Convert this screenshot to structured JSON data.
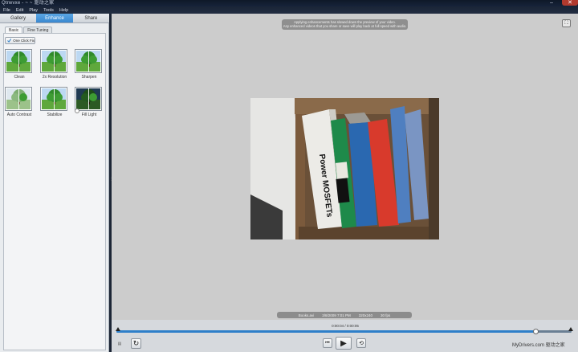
{
  "window": {
    "title": "Qtrwvxe - ~ ~ 驱动之家",
    "min_glyph": "–",
    "close_glyph": "✕"
  },
  "menu": [
    "File",
    "Edit",
    "Play",
    "Tools",
    "Help"
  ],
  "tabs": [
    {
      "label": "Gallery",
      "active": false
    },
    {
      "label": "Enhance",
      "active": true
    },
    {
      "label": "Share",
      "active": false
    }
  ],
  "subtabs": [
    {
      "label": "Basic",
      "active": true
    },
    {
      "label": "Fine Tuning",
      "active": false
    }
  ],
  "one_click_fix": {
    "label": "One Click Fix",
    "icon": "checkmark-icon"
  },
  "effects": [
    {
      "label": "Clean"
    },
    {
      "label": "2x Resolution"
    },
    {
      "label": "Sharpen"
    },
    {
      "label": "Auto Contrast"
    },
    {
      "label": "Stabilize"
    },
    {
      "label": "Fill Light"
    }
  ],
  "notice": {
    "line1": "Applying enhancements has slowed down the preview of your video.",
    "line2": "Any enhanced videos that you share or save will play back at full speed with audio."
  },
  "fullscreen": {
    "icon": "fullscreen-icon",
    "glyph": "⛶"
  },
  "info": {
    "filename": "Books.avi",
    "date": "3/8/2009 7:01 PM",
    "resolution": "320x240",
    "fps": "30 fps"
  },
  "player": {
    "timecode": "0:00:04 / 0:00:05",
    "progress": 0.92,
    "mute_glyph": "▤",
    "rotate_glyph": "↻",
    "prev_glyph": "⏮",
    "play_glyph": "▶",
    "loop_glyph": "⟲"
  },
  "watermark": "MyDrivers.com 驱动之家",
  "colors": {
    "accent": "#3a88d0",
    "tab_active": "#5aa6e4",
    "stage_bg": "#cccccc"
  }
}
